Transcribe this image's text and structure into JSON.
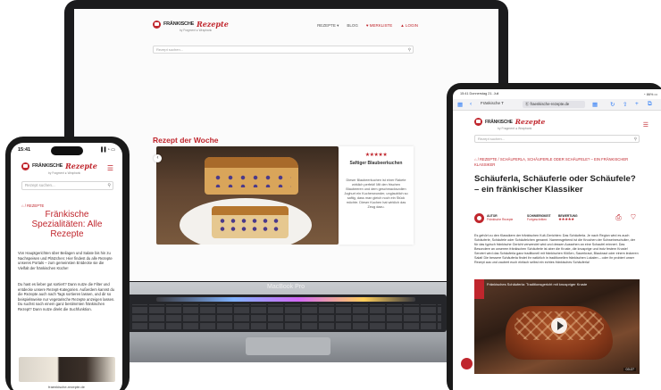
{
  "brand": {
    "logo_part1": "FRÄNKISCHE",
    "logo_part2": "Rezepte",
    "tagline": "by Fragment  ● Wrapbank",
    "accent_color": "#c0262d"
  },
  "laptop": {
    "model_label": "MacBook Pro",
    "nav": [
      "REZEPTE ▾",
      "BLOG",
      "♥ MERKLISTE",
      "▲ LOGIN"
    ],
    "search_placeholder": "Rezept suchen...",
    "section_title": "Rezept der Woche",
    "card": {
      "rating": "★★★★★",
      "name": "Saftiger Blaubeerkuchen",
      "description": "Dieser Blaubeerkuchen ist einer Rakete wirklich perfekt! Mit den frischen Blaubeeren und dem geschmacksvollen Joghurt ein Kuchenwunder, unglaublich so saftig, dass man gleich noch ein Stück möchte. Dieser Kuchen hat wirklich das Zeug dazu."
    }
  },
  "phone": {
    "time": "15:41",
    "signal": "▐▐ ◔ ▭",
    "search_placeholder": "Rezept suchen...",
    "breadcrumb": "⌂ / REZEPTE",
    "title": "Fränkische Spezialitäten: Alle Rezepte",
    "paragraph1": "Von Hauptgerichten über Beilagen und Salate bis hin zu Nachspeisen und Plätzchen: Hier findest du alle Rezepte unseres Portals – zum gemeinsten Entdecke sie die Vielfalt der fränkischen Küche!",
    "paragraph2": "Du hast es lieber gut sortiert? Dann nutze die Filter und entdecke unsere Rezept-Kategorien. Außerdem kannst du die Rezepte auch nach Tags sortieren lassen, und dir so beispielsweise nur vegetarische Rezepte anzeigen lassen. Du suchst nach einem ganz bestimmten fränkischen Rezept? Dann nutze direkt die Suchfunktion.",
    "url": "fraenkische-rezepte.de"
  },
  "tablet": {
    "status_left": "15:41  Donnerstag 21. Juli",
    "status_right": "◔ 86% ▭",
    "tab_label": "Fränkische T",
    "url": "Ⓔ fraenkische-rezepte.de",
    "search_placeholder": "Rezept suchen...",
    "breadcrumb": "⌂ / REZEPTE / SCHÄUFERLA, SCHÄUFERLE ODER SCHÄUFELE? – EIN FRÄNKISCHER KLASSIKER",
    "title": "Schäuferla, Schäuferle oder Schäufele? – ein fränkischer Klassiker",
    "meta": [
      {
        "label": "AUTOR",
        "value": "Fränkische Rezepte"
      },
      {
        "label": "SCHWIERIGKEIT",
        "value": "Fortgeschritten"
      },
      {
        "label": "BEWERTUNG",
        "value": "★★★★★"
      }
    ],
    "actions": "⎙ ♡",
    "body": "Es gehört zu den Klassikern der fränkischen Kult-Gerichten: Das Schäuferla. Je nach Region wird es auch Schäuferle, Schäufele oder Schäufelchen genannt. Namensgebend ist die Knochen der Schweineschulter, der für das typisch fränkische Gericht verwendet wird und dessen Aussehen an eine Schaufel erinnert. Das Besondere an unserem fränkischen Schäuferle ist aber die Kruste, die knusprige und trotz festem Kruste! Serviert wird das Schäuferla ganz traditionell mit fränkischen Klößen, Sauerkraut, Blaukraut oder einem leckeren Salat! Die bessere Schäuferla findet ihr natürlich in traditionellen fränkischen Lokalen – oder ihr probiert unser Rezept aus und zaubert euch einfach selbst ein echtes fränkisches Schäuferla!",
    "video_title": "Fränkisches Schäuferla: Traditionsgericht mit knuspriger Kruste",
    "video_time": "03:27"
  }
}
